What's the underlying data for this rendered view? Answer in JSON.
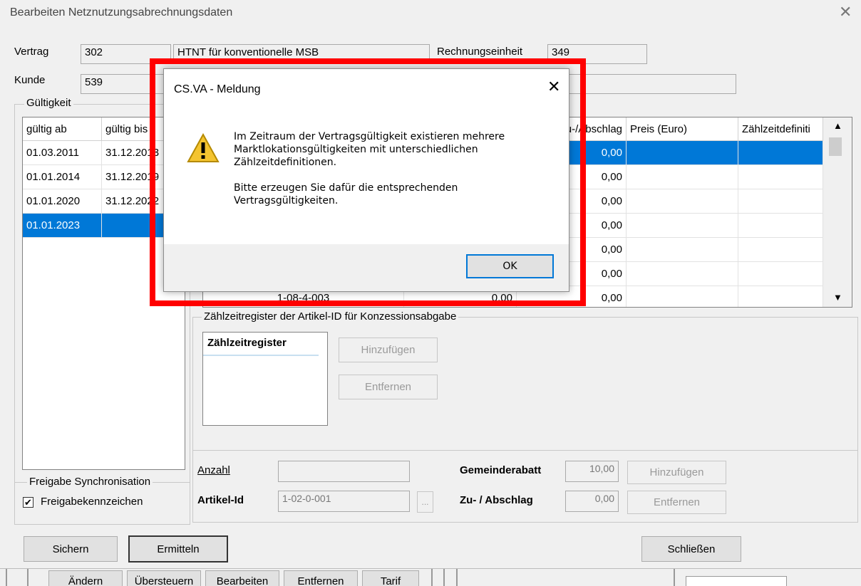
{
  "window": {
    "title": "Bearbeiten Netznutzungsabrechnungsdaten"
  },
  "contract": {
    "vertrag_label": "Vertrag",
    "vertrag_id": "302",
    "vertrag_desc": "HTNT für konventionelle MSB",
    "rechnungseinheit_label": "Rechnungseinheit",
    "rechnungseinheit_value": "349",
    "kunde_label": "Kunde",
    "kunde_id": "539"
  },
  "validity": {
    "group_title": "Gültigkeit",
    "col_from": "gültig ab",
    "col_to": "gültig bis",
    "rows": [
      {
        "from": "01.03.2011",
        "to": "31.12.2013"
      },
      {
        "from": "01.01.2014",
        "to": "31.12.2019"
      },
      {
        "from": "01.01.2020",
        "to": "31.12.2022"
      },
      {
        "from": "01.01.2023",
        "to": ""
      }
    ]
  },
  "articles": {
    "col_zuschlag": "Zu-/Abschlag",
    "col_preis": "Preis (Euro)",
    "col_zzd": "Zählzeitdefiniti",
    "rows": [
      {
        "article": "",
        "value": "",
        "zuschlag": "0,00"
      },
      {
        "article": "",
        "value": "",
        "zuschlag": "0,00"
      },
      {
        "article": "",
        "value": "",
        "zuschlag": "0,00"
      },
      {
        "article": "",
        "value": "",
        "zuschlag": "0,00"
      },
      {
        "article": "",
        "value": "",
        "zuschlag": "0,00"
      },
      {
        "article": "",
        "value": "",
        "zuschlag": "0,00"
      },
      {
        "article": "1-08-4-003",
        "value": "0,00",
        "zuschlag": "0,00"
      }
    ]
  },
  "zzr": {
    "group_title": "Zählzeitregister der Artikel-ID für Konzessionsabgabe",
    "list_header": "Zählzeitregister",
    "add_button": "Hinzufügen",
    "remove_button": "Entfernen"
  },
  "bottom_form": {
    "anzahl_label": "Anzahl",
    "anzahl_value": "",
    "artikel_label": "Artikel-Id",
    "artikel_value": "1-02-0-001",
    "browse_label": "...",
    "gemeinderabatt_label": "Gemeinderabatt",
    "gemeinderabatt_value": "10,00",
    "zuabschlag_label": "Zu- / Abschlag",
    "zuabschlag_value": "0,00",
    "add_button": "Hinzufügen",
    "remove_button": "Entfernen"
  },
  "sync": {
    "group_title": "Freigabe Synchronisation",
    "checkbox_label": "Freigabekennzeichen",
    "checked": true
  },
  "actions": {
    "save": "Sichern",
    "calculate": "Ermitteln",
    "close": "Schließen"
  },
  "behind_bar": {
    "buttons": [
      "Ändern",
      "Übersteuern",
      "Bearbeiten",
      "Entfernen",
      "Tarif"
    ]
  },
  "dialog": {
    "title": "CS.VA - Meldung",
    "message_line1": "Im Zeitraum der Vertragsgültigkeit existieren mehrere",
    "message_line2": "Marktlokationsgültigkeiten mit unterschiedlichen",
    "message_line3": "Zählzeitdefinitionen.",
    "message_line4": "Bitte erzeugen Sie dafür die entsprechenden",
    "message_line5": "Vertragsgültigkeiten.",
    "ok_button": "OK"
  },
  "colors": {
    "selection": "#0078d7",
    "highlight_frame": "#ff0000"
  }
}
